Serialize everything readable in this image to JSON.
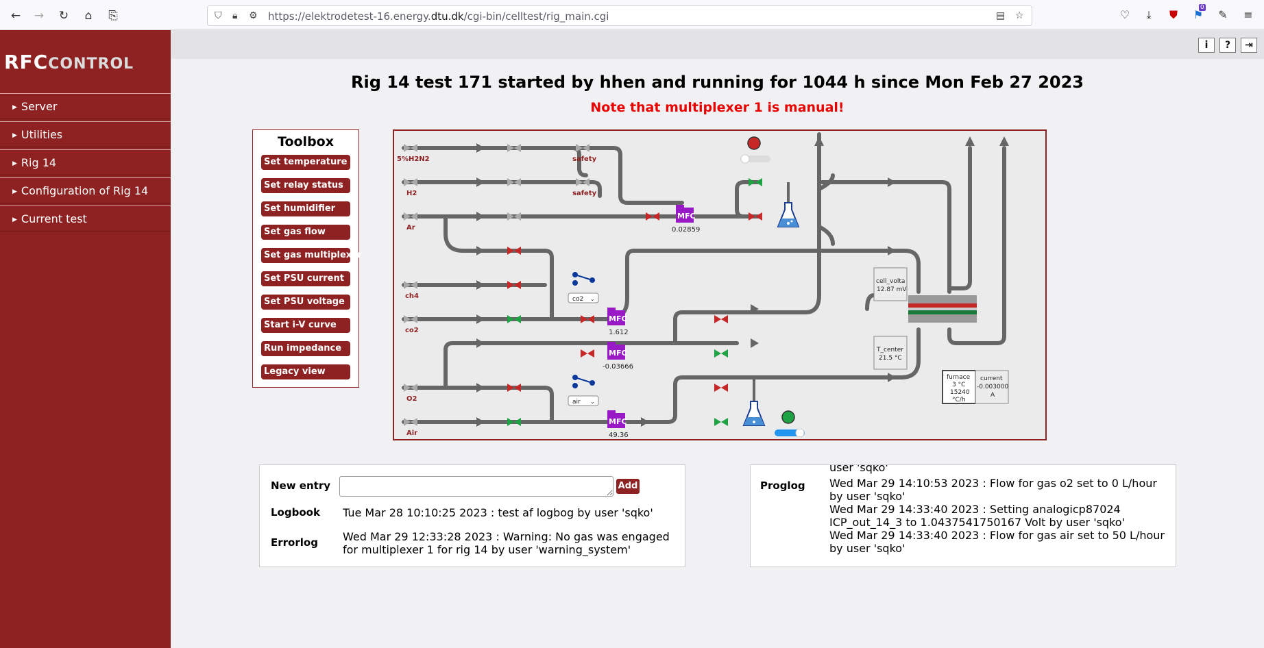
{
  "browser": {
    "url_prefix": "https://elektrodetest-16.energy.",
    "url_domain": "dtu.dk",
    "url_path": "/cgi-bin/celltest/rig_main.cgi",
    "notification_badge": "0"
  },
  "logo": {
    "part1": "RFC",
    "part2": "CONTROL"
  },
  "sidebar": {
    "items": [
      {
        "label": "Server"
      },
      {
        "label": "Utilities"
      },
      {
        "label": "Rig 14"
      },
      {
        "label": "Configuration of Rig 14"
      },
      {
        "label": "Current test"
      }
    ]
  },
  "header": {
    "info_icon": "i",
    "help_icon": "?",
    "logout_icon": "⇥"
  },
  "title": "Rig 14 test 171 started by hhen and running for 1044 h since Mon Feb 27 2023",
  "note": "Note that multiplexer 1 is manual!",
  "toolbox": {
    "title": "Toolbox",
    "buttons": [
      "Set temperature",
      "Set relay status",
      "Set humidifier",
      "Set gas flow",
      "Set gas multiplexer",
      "Set PSU current",
      "Set PSU voltage",
      "Start i-V curve",
      "Run impedance",
      "Legacy view"
    ]
  },
  "diagram": {
    "gas_labels": [
      "5%H2N2",
      "H2",
      "Ar",
      "ch4",
      "co2",
      "O2",
      "Air"
    ],
    "safety_labels": [
      "safety",
      "safety"
    ],
    "mfc_label": "MFC",
    "mfc_values": [
      "0.02859",
      "1.612",
      "-0.03666",
      "49.36"
    ],
    "mux1_select": "co2",
    "mux2_select": "air",
    "cell_voltage": {
      "label": "cell_volta",
      "value": "12.87 mV"
    },
    "t_center": {
      "label": "T_center",
      "value": "21.5 °C"
    },
    "furnace": {
      "label": "furnace",
      "temp": "3 °C",
      "rate": "15240",
      "unit": "°C/h"
    },
    "current": {
      "label": "current",
      "value": "-0.003000",
      "unit": "A"
    },
    "colors": {
      "valve_closed": "#c62828",
      "valve_open": "#1fa244",
      "valve_grey": "#aaaaaa",
      "mfc": "#9a19c7",
      "pipe": "#666666"
    }
  },
  "logbook": {
    "new_entry_label": "New entry",
    "add_label": "Add",
    "logbook_label": "Logbook",
    "logbook_text": "Tue Mar 28 10:10:25 2023 : test af logbog by user 'sqko'",
    "errorlog_label": "Errorlog",
    "errorlog_line1": "Wed Mar 29 12:33:28 2023 : Warning: No gas was engaged",
    "errorlog_line2": "for multiplexer 1 for rig 14 by user 'warning_system'"
  },
  "proglog": {
    "label": "Proglog",
    "lines": [
      "user 'sqko'",
      "Wed Mar 29 14:10:53 2023 : Flow for gas o2 set to 0 L/hour",
      "by user 'sqko'",
      "Wed Mar 29 14:33:40 2023 : Setting analogicp87024",
      "ICP_out_14_3 to 1.0437541750167 Volt by user 'sqko'",
      "Wed Mar 29 14:33:40 2023 : Flow for gas air set to 50 L/hour",
      "by user 'sqko'"
    ]
  }
}
